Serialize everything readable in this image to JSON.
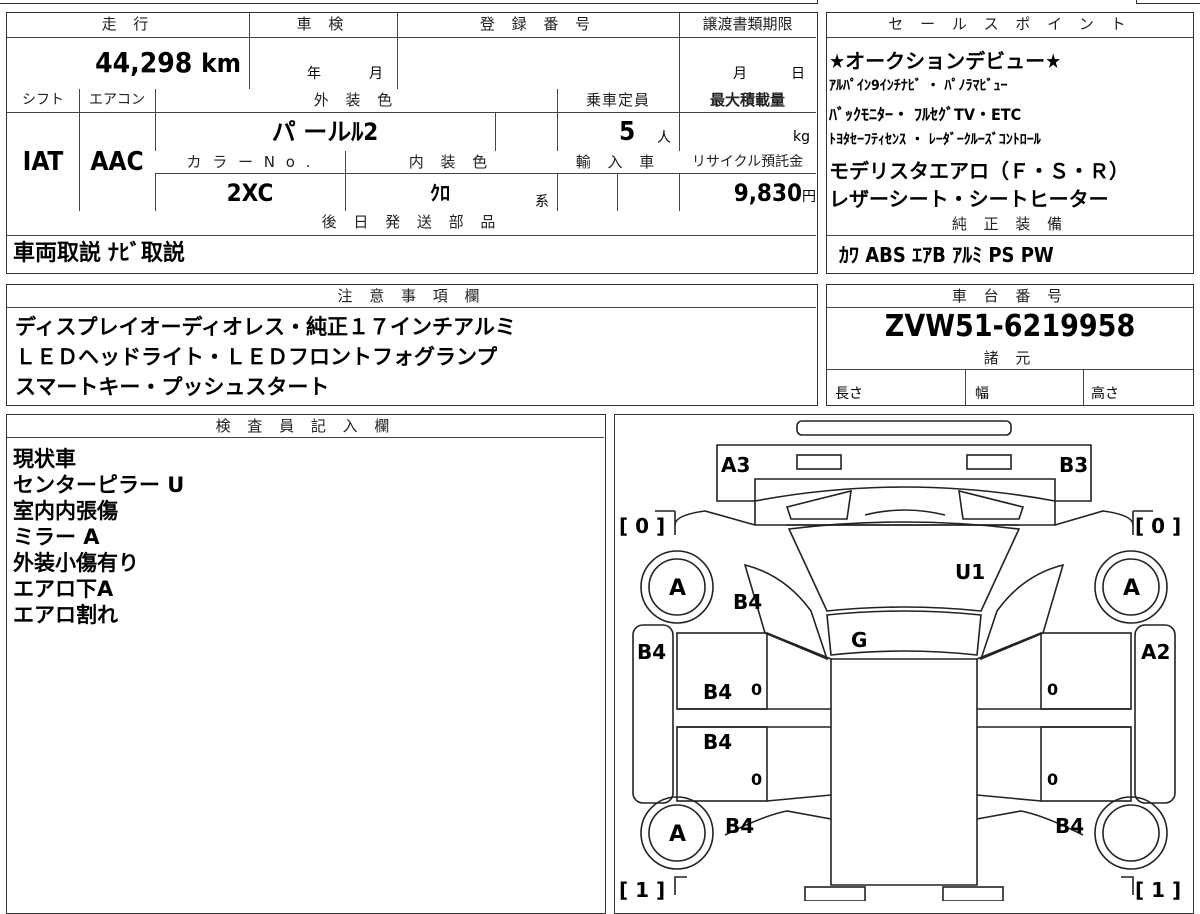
{
  "top": {
    "mileage_label": "走 行",
    "mileage_value": "44,298",
    "mileage_unit": "km",
    "inspection_label": "車 検",
    "inspection_year": "年",
    "inspection_month": "月",
    "registration_label": "登 録 番 号",
    "transfer_label": "譲渡書類期限",
    "transfer_month": "月",
    "transfer_day": "日",
    "shift_label": "シフト",
    "shift_value": "IAT",
    "ac_label": "エアコン",
    "ac_value": "AAC",
    "exterior_label": "外 装 色",
    "exterior_value": "パ ールﾙ2",
    "capacity_label": "乗車定員",
    "capacity_value": "5",
    "capacity_unit": "人",
    "load_label": "最大積載量",
    "load_unit": "kg",
    "color_no_label": "カ ラ ー N o .",
    "color_no_value": "2XC",
    "interior_label": "内 装 色",
    "interior_value": "ｸﾛ",
    "interior_suffix": "系",
    "import_label": "輸 入 車",
    "recycle_label": "リサイクル預託金",
    "recycle_value": "9,830",
    "recycle_unit": "円",
    "later_label": "後 日 発 送 部 品",
    "later_value": "車両取説 ﾅﾋﾞ取説"
  },
  "sales": {
    "label": "セ ー ル ス ポ イ ン ト",
    "lines": [
      "★オークションデビュー★",
      "ｱﾙﾊﾟｲﾝ9ｲﾝﾁﾅﾋﾞ ・ ﾊﾟﾉﾗﾏﾋﾞｭｰ",
      "ﾊﾞｯｸﾓﾆﾀｰ・ ﾌﾙｾｸﾞTV・ETC",
      "ﾄﾖﾀｾｰﾌﾃｨｾﾝｽ ・ ﾚｰﾀﾞｰｸﾙｰｽﾞｺﾝﾄﾛｰﾙ",
      "モデリスタエアロ（Ｆ・Ｓ・Ｒ）",
      "レザーシート・シートヒーター"
    ],
    "equip_label": "純 正 装 備",
    "equip_value": "ｶﾜ ABS ｴｱB ｱﾙﾐ PS PW"
  },
  "notes": {
    "label": "注 意 事 項 欄",
    "lines": [
      "ディスプレイオーディオレス・純正１７インチアルミ",
      "ＬＥＤヘッドライト・ＬＥＤフロントフォグランプ",
      "スマートキー・プッシュスタート"
    ]
  },
  "chassis": {
    "label": "車 台 番 号",
    "value": "ZVW51-6219958",
    "spec_label": "諸 元",
    "length": "長さ",
    "width": "幅",
    "height": "高さ"
  },
  "inspector": {
    "label": "検 査 員 記 入 欄",
    "lines": [
      "現状車",
      "センターピラー U",
      "室内内張傷",
      "ミラー A",
      "外装小傷有り",
      "エアロ下A",
      "エアロ割れ"
    ]
  },
  "diagram": {
    "front_left": "A3",
    "front_right": "B3",
    "bracket_tl": "[ 0 ]",
    "bracket_tr": "[ 0 ]",
    "bracket_bl": "[ 1 ]",
    "bracket_br": "[ 1 ]",
    "wheel_fl": "A",
    "wheel_fr": "A",
    "wheel_rl": "A",
    "fender_fl": "B4",
    "hood": "U1",
    "windshield": "G",
    "side_left": "B4",
    "side_right": "A2",
    "door_fl": "B4",
    "door_rl": "B4",
    "rear_fl": "B4",
    "rear_fr": "B4",
    "mark_0": "0"
  }
}
